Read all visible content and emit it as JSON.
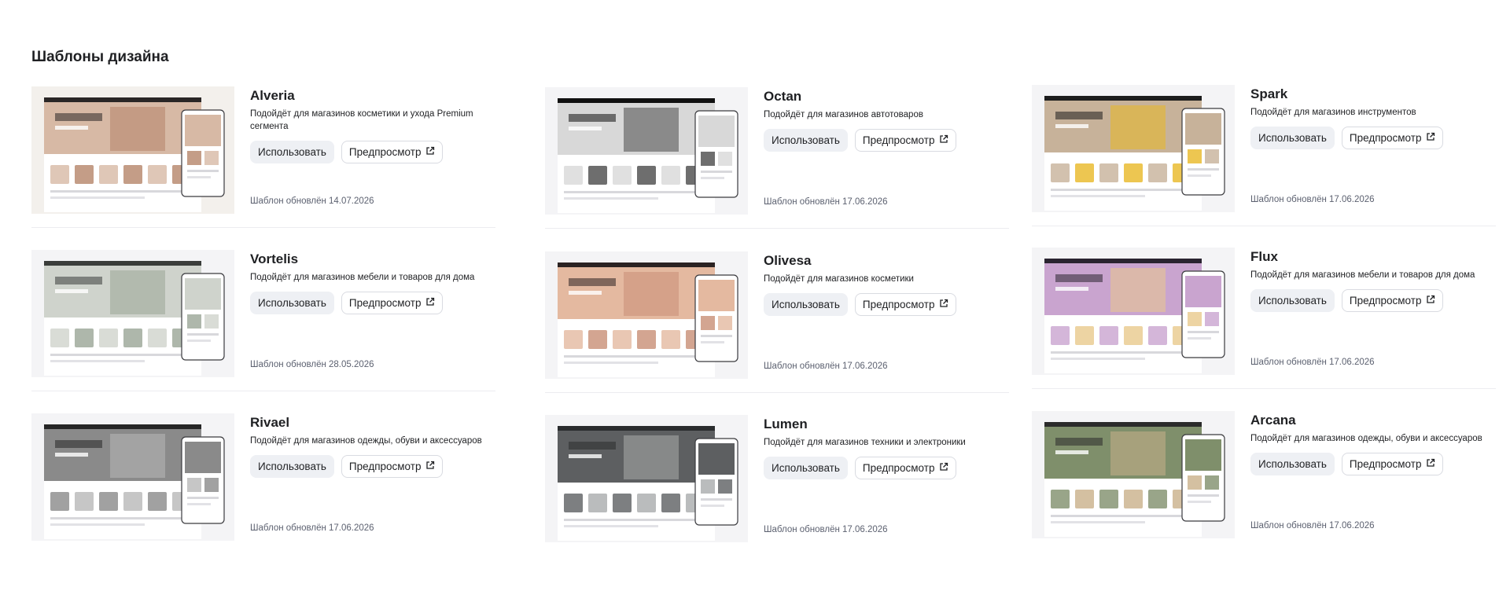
{
  "page": {
    "title": "Шаблоны дизайна"
  },
  "labels": {
    "use": "Использовать",
    "preview": "Предпросмотр"
  },
  "columns": [
    [
      {
        "name": "Alveria",
        "description": "Подойдёт для магазинов косметики и ухода Premium сегмента",
        "updated": "Шаблон обновлён 14.07.2026",
        "thumb": {
          "bg": "#f3f0ec",
          "hero": "#d7b9a5",
          "accent": "#b58469",
          "dark": "#2a2626"
        }
      },
      {
        "name": "Vortelis",
        "description": "Подойдёт для магазинов мебели и товаров для дома",
        "updated": "Шаблон обновлён 28.05.2026",
        "thumb": {
          "bg": "#f4f4f6",
          "hero": "#cfd3cc",
          "accent": "#9aa596",
          "dark": "#3a3d3a"
        }
      },
      {
        "name": "Rivael",
        "description": "Подойдёт для магазинов одежды, обуви и аксессуаров",
        "updated": "Шаблон обновлён 17.06.2026",
        "thumb": {
          "bg": "#f4f4f6",
          "hero": "#8a8a8a",
          "accent": "#b8b8b8",
          "dark": "#262626"
        }
      }
    ],
    [
      {
        "name": "Octan",
        "description": "Подойдёт для магазинов автотоваров",
        "updated": "Шаблон обновлён 17.06.2026",
        "thumb": {
          "bg": "#f4f4f6",
          "hero": "#d8d8d8",
          "accent": "#4a4a4a",
          "dark": "#111111"
        }
      },
      {
        "name": "Olivesa",
        "description": "Подойдёт для магазинов косметики",
        "updated": "Шаблон обновлён 17.06.2026",
        "thumb": {
          "bg": "#f4f4f6",
          "hero": "#e4b9a0",
          "accent": "#c88e76",
          "dark": "#2b2323"
        }
      },
      {
        "name": "Lumen",
        "description": "Подойдёт для магазинов техники и электроники",
        "updated": "Шаблон обновлён 17.06.2026",
        "thumb": {
          "bg": "#f4f4f6",
          "hero": "#5d5f61",
          "accent": "#a9abac",
          "dark": "#2a2c2e"
        }
      }
    ],
    [
      {
        "name": "Spark",
        "description": "Подойдёт для магазинов инструментов",
        "updated": "Шаблон обновлён 17.06.2026",
        "thumb": {
          "bg": "#f4f4f6",
          "hero": "#c7b29a",
          "accent": "#e8b825",
          "dark": "#1d1d1d"
        }
      },
      {
        "name": "Flux",
        "description": "Подойдёт для магазинов мебели и товаров для дома",
        "updated": "Шаблон обновлён 17.06.2026",
        "thumb": {
          "bg": "#f4f4f6",
          "hero": "#c9a4cf",
          "accent": "#e9c98c",
          "dark": "#2a2430"
        }
      },
      {
        "name": "Arcana",
        "description": "Подойдёт для магазинов одежды, обуви и аксессуаров",
        "updated": "Шаблон обновлён 17.06.2026",
        "thumb": {
          "bg": "#f4f4f6",
          "hero": "#7f8f6b",
          "accent": "#c9b08a",
          "dark": "#2b2b2b"
        }
      }
    ]
  ]
}
